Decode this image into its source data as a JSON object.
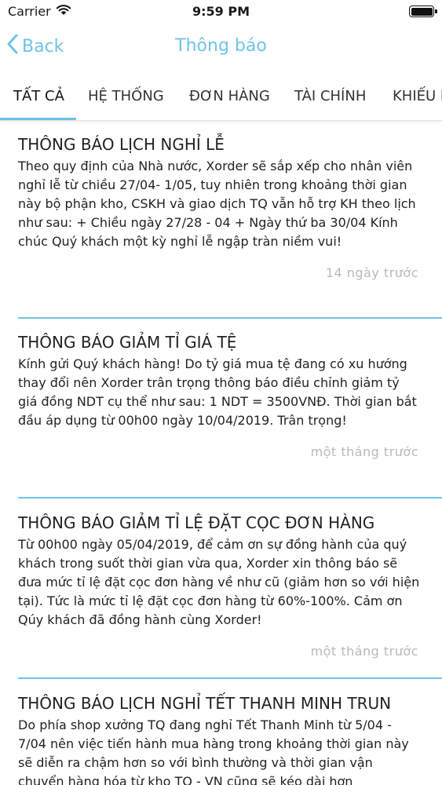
{
  "status": {
    "carrier": "Carrier",
    "time": "9:59 PM",
    "battery_level": 1.0
  },
  "nav": {
    "back_label": "Back",
    "title": "Thông báo"
  },
  "tabs": [
    {
      "label": "TẤT CẢ",
      "active": true
    },
    {
      "label": "HỆ THỐNG"
    },
    {
      "label": "ĐƠN HÀNG"
    },
    {
      "label": "TÀI CHÍNH"
    },
    {
      "label": "KHIẾU NẠI"
    }
  ],
  "notifications": [
    {
      "title": "THÔNG BÁO LỊCH NGHỈ LỄ",
      "body": "Theo quy định của Nhà nước, Xorder sẽ sắp xếp cho nhân viên nghỉ lễ từ chiều 27/04- 1/05, tuy nhiên trong khoảng thời gian này bộ phận kho, CSKH và giao dịch TQ vẫn hỗ trợ KH theo lịch như sau: + Chiều ngày 27/28 - 04 + Ngày thứ ba 30/04 Kính chúc Quý khách một kỳ nghỉ lễ ngập tràn niềm vui!",
      "time": "14 ngày trước"
    },
    {
      "title": "THÔNG BÁO GIẢM TỈ GIÁ TỆ",
      "body": "Kính gửi Quý khách hàng! Do tỷ giá mua tệ đang có xu hướng thay đổi nên Xorder trân trọng thông báo điều chỉnh giảm tỷ giá đồng NDT cụ thể như sau: 1 NDT = 3500VNĐ. Thời gian bắt đầu áp dụng từ 00h00 ngày 10/04/2019. Trân trọng!",
      "time": "một tháng trước"
    },
    {
      "title": "THÔNG BÁO GIẢM TỈ LỆ ĐẶT CỌC ĐƠN HÀNG",
      "body": "Từ 00h00 ngày 05/04/2019, để cảm ơn sự đồng hành của quý khách trong suốt thời gian vừa qua, Xorder xin thông báo sẽ đưa mức tỉ lệ đặt cọc đơn hàng về như cũ (giảm hơn so với hiện tại). Tức là mức tỉ lệ đặt cọc đơn hàng từ 60%-100%. Cảm ơn Qúy khách đã đồng hành cùng Xorder!",
      "time": "một tháng trước"
    },
    {
      "title": "THÔNG BÁO LỊCH NGHỈ TẾT THANH MINH TRUN",
      "body": "Do phía shop xưởng TQ đang nghỉ Tết Thanh Minh từ 5/04 - 7/04 nên việc tiến hành mua hàng trong khoảng thời gian này sẽ diễn ra chậm hơn so với bình thường và thời gian vận chuyển hàng hóa từ kho TQ - VN cũng sẽ kéo dài hơn",
      "time": ""
    }
  ]
}
